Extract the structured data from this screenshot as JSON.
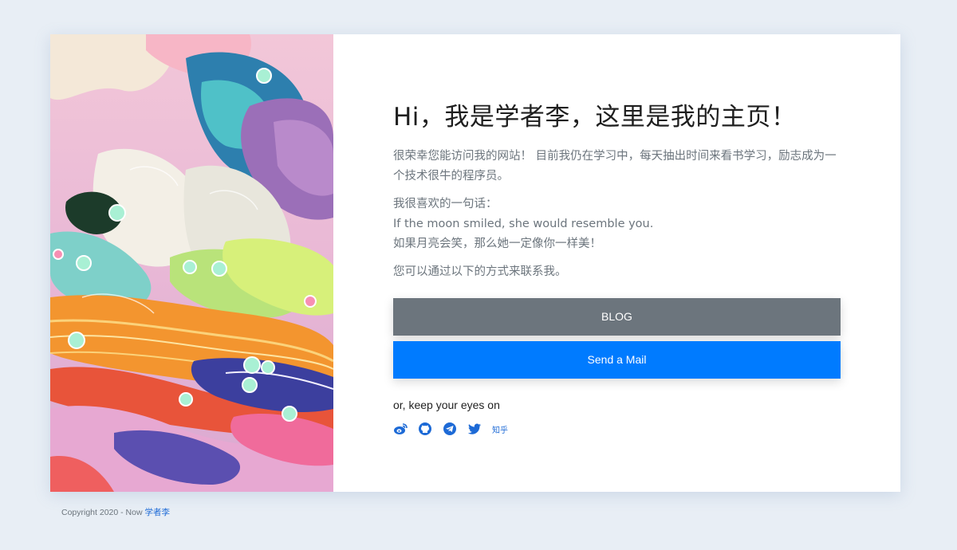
{
  "hero": {
    "title": "Hi，我是学者李，这里是我的主页！",
    "intro": "很荣幸您能访问我的网站！ 目前我仍在学习中，每天抽出时间来看书学习，励志成为一个技术很牛的程序员。",
    "quote_label": "我很喜欢的一句话：",
    "quote_en": "If the moon smiled, she would resemble you.",
    "quote_zh": "如果月亮会笑，那么她一定像你一样美！",
    "contact_text": "您可以通过以下的方式来联系我。"
  },
  "buttons": {
    "blog_label": "BLOG",
    "mail_label": "Send a Mail"
  },
  "social": {
    "heading": "or, keep your eyes on",
    "icons": [
      "weibo-icon",
      "github-icon",
      "telegram-icon",
      "twitter-icon"
    ],
    "zhihu_label": "知乎"
  },
  "footer": {
    "copyright": "Copyright 2020 - Now ",
    "author_link": "学者李"
  },
  "colors": {
    "background": "#e8eef5",
    "blog_button": "#6c757d",
    "mail_button": "#007bff",
    "link": "#1d6ad6"
  }
}
